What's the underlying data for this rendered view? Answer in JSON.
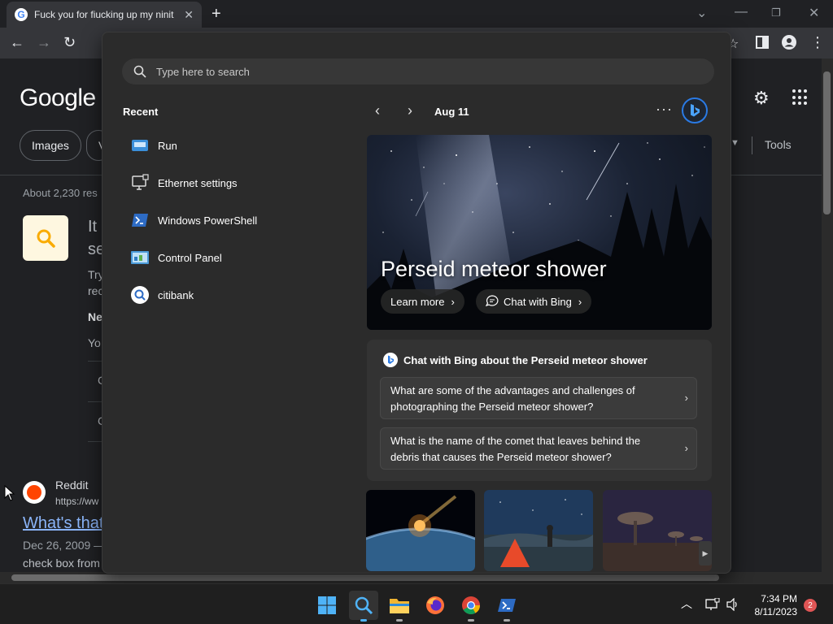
{
  "browser": {
    "tab_title": "Fuck you for fiucking up my ninit",
    "tab_favicon": "google-g-icon",
    "window_controls": [
      "chevron-down-icon",
      "minimize-icon",
      "restore-icon",
      "close-icon"
    ]
  },
  "google": {
    "logo": "Google",
    "chips": [
      "Images",
      "V"
    ],
    "tools_label": "Tools",
    "about": "About 2,230 res",
    "fragments": {
      "it": "It",
      "se": "se",
      "try": "Try",
      "rec": "rec",
      "ne": "Ne",
      "yo": "Yo",
      "c1": "C",
      "c2": "C"
    },
    "result": {
      "site": "Reddit",
      "url": "https://ww",
      "title": "What's that",
      "date": "Dec 26, 2009 —",
      "snippet": "check box from"
    }
  },
  "flyout": {
    "search_placeholder": "Type here to search",
    "recent_heading": "Recent",
    "recent_items": [
      {
        "label": "Run",
        "icon": "run-icon"
      },
      {
        "label": "Ethernet settings",
        "icon": "ethernet-settings-icon"
      },
      {
        "label": "Windows PowerShell",
        "icon": "powershell-icon"
      },
      {
        "label": "Control Panel",
        "icon": "control-panel-icon"
      },
      {
        "label": "citibank",
        "icon": "search-icon"
      }
    ],
    "date": "Aug 11",
    "hero": {
      "title": "Perseid meteor shower",
      "learn_more": "Learn more",
      "chat_with_bing": "Chat with Bing"
    },
    "chat": {
      "heading": "Chat with Bing about the Perseid meteor shower",
      "questions": [
        "What are some of the advantages and challenges of photographing the Perseid meteor shower?",
        "What is the name of the comet that leaves behind the debris that causes the Perseid meteor shower?"
      ]
    }
  },
  "taskbar": {
    "apps": [
      "windows-start-icon",
      "search-icon",
      "file-explorer-icon",
      "firefox-icon",
      "chrome-icon",
      "powershell-icon"
    ],
    "time": "7:34 PM",
    "date": "8/11/2023",
    "notification_count": "2"
  },
  "colors": {
    "accent": "#2a7ae4",
    "flyout_bg": "#2b2b2b",
    "page_bg": "#202124",
    "link": "#8ab4f8",
    "notification": "#e05555"
  }
}
